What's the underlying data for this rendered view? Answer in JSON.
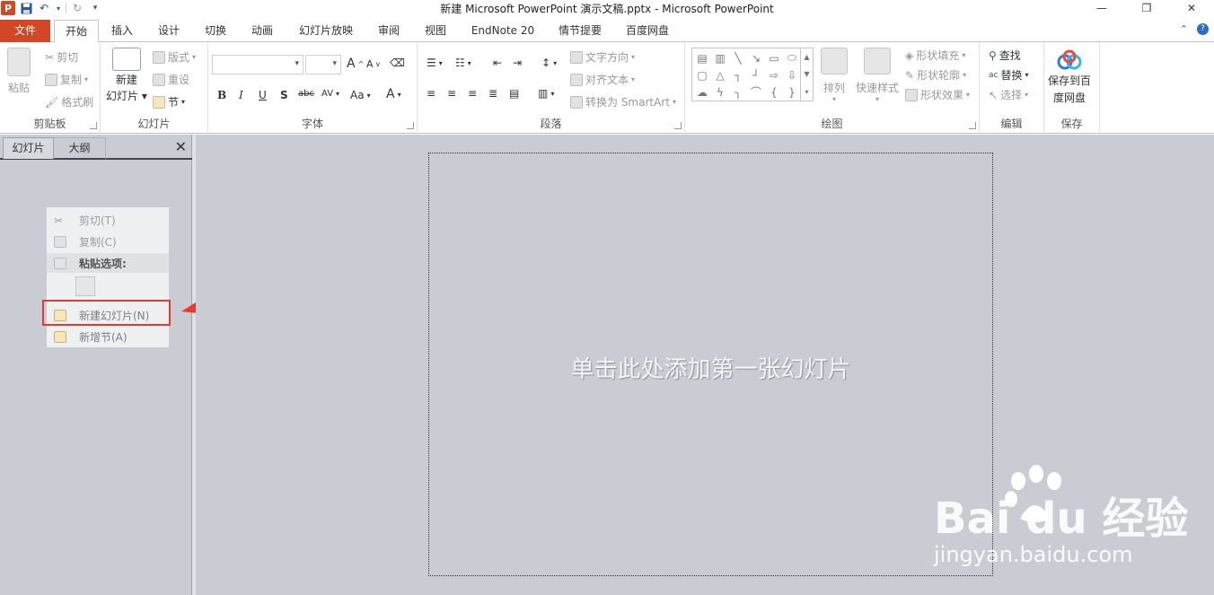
{
  "window": {
    "title": "新建 Microsoft PowerPoint 演示文稿.pptx  -  Microsoft PowerPoint",
    "app_icon": "P",
    "controls": [
      "minimize-icon",
      "restore-icon",
      "close-icon"
    ]
  },
  "tabs": [
    {
      "label": "文件"
    },
    {
      "label": "开始"
    },
    {
      "label": "插入"
    },
    {
      "label": "设计"
    },
    {
      "label": "切换"
    },
    {
      "label": "动画"
    },
    {
      "label": "幻灯片放映"
    },
    {
      "label": "审阅"
    },
    {
      "label": "视图"
    },
    {
      "label": "EndNote 20"
    },
    {
      "label": "情节提要"
    },
    {
      "label": "百度网盘"
    }
  ],
  "ribbon": {
    "clipboard": {
      "paste": "粘贴",
      "cut": "剪切",
      "copy": "复制",
      "format_painter": "格式刷",
      "label": "剪贴板"
    },
    "slides": {
      "new_slide_1": "新建",
      "new_slide_2": "幻灯片",
      "layout": "版式",
      "reset": "重设",
      "section": "节",
      "label": "幻灯片"
    },
    "font": {
      "label": "字体",
      "bold": "B",
      "italic": "I",
      "underline": "U",
      "shadow": "S",
      "strike": "abc",
      "spacing": "AV",
      "case": "Aa",
      "color": "A",
      "grow": "A",
      "shrink": "A"
    },
    "paragraph": {
      "text_direction": "文字方向",
      "align_text": "对齐文本",
      "smartart": "转换为 SmartArt",
      "label": "段落"
    },
    "drawing": {
      "arrange": "排列",
      "quick_styles": "快速样式",
      "fill": "形状填充",
      "outline": "形状轮廓",
      "effects": "形状效果",
      "label": "绘图"
    },
    "editing": {
      "find": "查找",
      "replace": "替换",
      "select": "选择",
      "label": "编辑"
    },
    "save": {
      "line1": "保存到百",
      "line2": "度网盘",
      "label": "保存"
    }
  },
  "left_pane": {
    "tab_slides": "幻灯片",
    "tab_outline": "大纲",
    "close": "✕"
  },
  "context_menu": {
    "cut": "剪切(T)",
    "copy": "复制(C)",
    "paste_options": "粘贴选项:",
    "new_slide": "新建幻灯片(N)",
    "new_section": "新增节(A)"
  },
  "slide": {
    "placeholder": "单击此处添加第一张幻灯片"
  },
  "watermark": {
    "logo": "Bai  du 经验",
    "url": "jingyan.baidu.com"
  },
  "colors": {
    "file_tab": "#d24726",
    "highlight": "#e23b30",
    "workspace": "#c9cdd3"
  }
}
